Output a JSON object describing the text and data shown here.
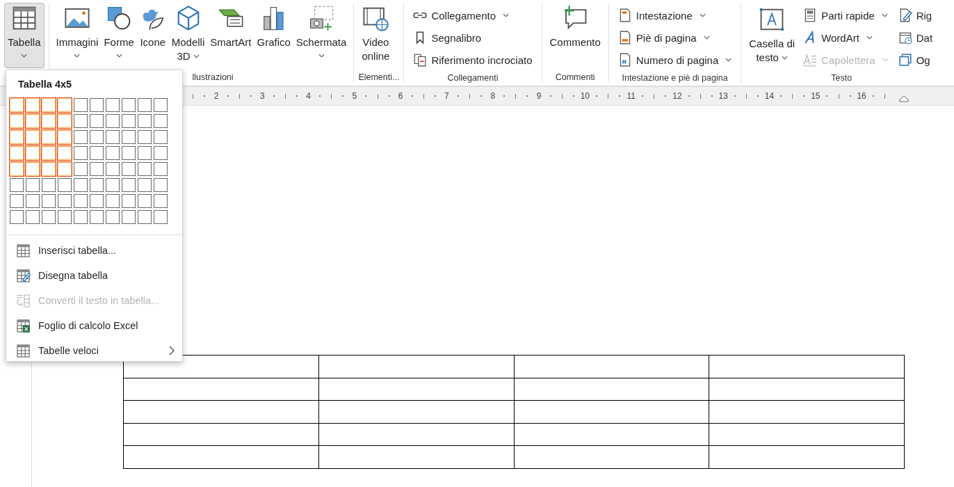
{
  "ribbon": {
    "groups": [
      {
        "items": [
          {
            "kind": "large",
            "lines": [
              "Tabella"
            ],
            "dropdown": true,
            "pressed": true
          }
        ]
      },
      {
        "label": "llustrazioni",
        "items": [
          {
            "kind": "large",
            "lines": [
              "Immagini"
            ],
            "dropdown": true,
            "pressed": false
          },
          {
            "kind": "large",
            "lines": [
              "Forme"
            ],
            "dropdown": true,
            "pressed": false
          },
          {
            "kind": "large",
            "lines": [
              "Icone"
            ],
            "dropdown": false,
            "pressed": false
          },
          {
            "kind": "large",
            "lines": [
              "Modelli",
              "3D"
            ],
            "dropdown": true,
            "pressed": false
          },
          {
            "kind": "large",
            "lines": [
              "SmartArt"
            ],
            "dropdown": false,
            "pressed": false
          },
          {
            "kind": "large",
            "lines": [
              "Grafico"
            ],
            "dropdown": false,
            "pressed": false
          },
          {
            "kind": "large",
            "lines": [
              "Schermata"
            ],
            "dropdown": true,
            "pressed": false
          }
        ]
      },
      {
        "label": "Elementi...",
        "items": [
          {
            "kind": "large",
            "lines": [
              "Video",
              "online"
            ],
            "dropdown": false,
            "pressed": false
          }
        ]
      },
      {
        "label": "Collegamenti",
        "items": [
          {
            "kind": "small",
            "label": "Collegamento",
            "dropdown": true,
            "disabled": false
          },
          {
            "kind": "small",
            "label": "Segnalibro",
            "dropdown": false,
            "disabled": false
          },
          {
            "kind": "small",
            "label": "Riferimento incrociato",
            "dropdown": false,
            "disabled": false
          }
        ]
      },
      {
        "label": "Commenti",
        "items": [
          {
            "kind": "large",
            "lines": [
              "Commento"
            ],
            "dropdown": false,
            "pressed": false
          }
        ]
      },
      {
        "label": "Intestazione e piè di pagina",
        "items": [
          {
            "kind": "small",
            "label": "Intestazione",
            "dropdown": true,
            "disabled": false
          },
          {
            "kind": "small",
            "label": "Piè di pagina",
            "dropdown": true,
            "disabled": false
          },
          {
            "kind": "small",
            "label": "Numero di pagina",
            "dropdown": true,
            "disabled": false
          }
        ]
      },
      {
        "label": "Testo",
        "items": [
          {
            "kind": "large",
            "lines": [
              "Casella di",
              "testo"
            ],
            "dropdown": true,
            "pressed": false
          },
          {
            "kind": "small",
            "label": "Parti rapide",
            "dropdown": true,
            "disabled": false
          },
          {
            "kind": "small",
            "label": "WordArt",
            "dropdown": true,
            "disabled": false
          },
          {
            "kind": "small",
            "label": "Capolettera",
            "dropdown": true,
            "disabled": true
          },
          {
            "kind": "small",
            "label": "Rig",
            "dropdown": false,
            "disabled": false
          },
          {
            "kind": "small",
            "label": "Dat",
            "dropdown": false,
            "disabled": false
          },
          {
            "kind": "small",
            "label": "Og",
            "dropdown": false,
            "disabled": false
          }
        ]
      }
    ]
  },
  "ruler": {
    "labels": [
      "2",
      "3",
      "4",
      "5",
      "6",
      "7",
      "8",
      "9",
      "10",
      "11",
      "12",
      "13",
      "14",
      "15",
      "16"
    ]
  },
  "menu": {
    "title": "Tabella 4x5",
    "grid_rows": [
      {
        "cells": [
          {
            "selected": true
          },
          {
            "selected": true
          },
          {
            "selected": true
          },
          {
            "selected": true
          },
          {
            "selected": false
          },
          {
            "selected": false
          },
          {
            "selected": false
          },
          {
            "selected": false
          },
          {
            "selected": false
          },
          {
            "selected": false
          }
        ]
      },
      {
        "cells": [
          {
            "selected": true
          },
          {
            "selected": true
          },
          {
            "selected": true
          },
          {
            "selected": true
          },
          {
            "selected": false
          },
          {
            "selected": false
          },
          {
            "selected": false
          },
          {
            "selected": false
          },
          {
            "selected": false
          },
          {
            "selected": false
          }
        ]
      },
      {
        "cells": [
          {
            "selected": true
          },
          {
            "selected": true
          },
          {
            "selected": true
          },
          {
            "selected": true
          },
          {
            "selected": false
          },
          {
            "selected": false
          },
          {
            "selected": false
          },
          {
            "selected": false
          },
          {
            "selected": false
          },
          {
            "selected": false
          }
        ]
      },
      {
        "cells": [
          {
            "selected": true
          },
          {
            "selected": true
          },
          {
            "selected": true
          },
          {
            "selected": true
          },
          {
            "selected": false
          },
          {
            "selected": false
          },
          {
            "selected": false
          },
          {
            "selected": false
          },
          {
            "selected": false
          },
          {
            "selected": false
          }
        ]
      },
      {
        "cells": [
          {
            "selected": true
          },
          {
            "selected": true
          },
          {
            "selected": true
          },
          {
            "selected": true
          },
          {
            "selected": false
          },
          {
            "selected": false
          },
          {
            "selected": false
          },
          {
            "selected": false
          },
          {
            "selected": false
          },
          {
            "selected": false
          }
        ]
      },
      {
        "cells": [
          {
            "selected": false
          },
          {
            "selected": false
          },
          {
            "selected": false
          },
          {
            "selected": false
          },
          {
            "selected": false
          },
          {
            "selected": false
          },
          {
            "selected": false
          },
          {
            "selected": false
          },
          {
            "selected": false
          },
          {
            "selected": false
          }
        ]
      },
      {
        "cells": [
          {
            "selected": false
          },
          {
            "selected": false
          },
          {
            "selected": false
          },
          {
            "selected": false
          },
          {
            "selected": false
          },
          {
            "selected": false
          },
          {
            "selected": false
          },
          {
            "selected": false
          },
          {
            "selected": false
          },
          {
            "selected": false
          }
        ]
      },
      {
        "cells": [
          {
            "selected": false
          },
          {
            "selected": false
          },
          {
            "selected": false
          },
          {
            "selected": false
          },
          {
            "selected": false
          },
          {
            "selected": false
          },
          {
            "selected": false
          },
          {
            "selected": false
          },
          {
            "selected": false
          },
          {
            "selected": false
          }
        ]
      }
    ],
    "items": [
      {
        "label": "Inserisci tabella...",
        "disabled": false,
        "submenu": false
      },
      {
        "label": "Disegna tabella",
        "disabled": false,
        "submenu": false
      },
      {
        "label": "Converti il testo in tabella...",
        "disabled": true,
        "submenu": false
      },
      {
        "label": "Foglio di calcolo Excel",
        "disabled": false,
        "submenu": false
      },
      {
        "label": "Tabelle veloci",
        "disabled": false,
        "submenu": true
      }
    ]
  }
}
